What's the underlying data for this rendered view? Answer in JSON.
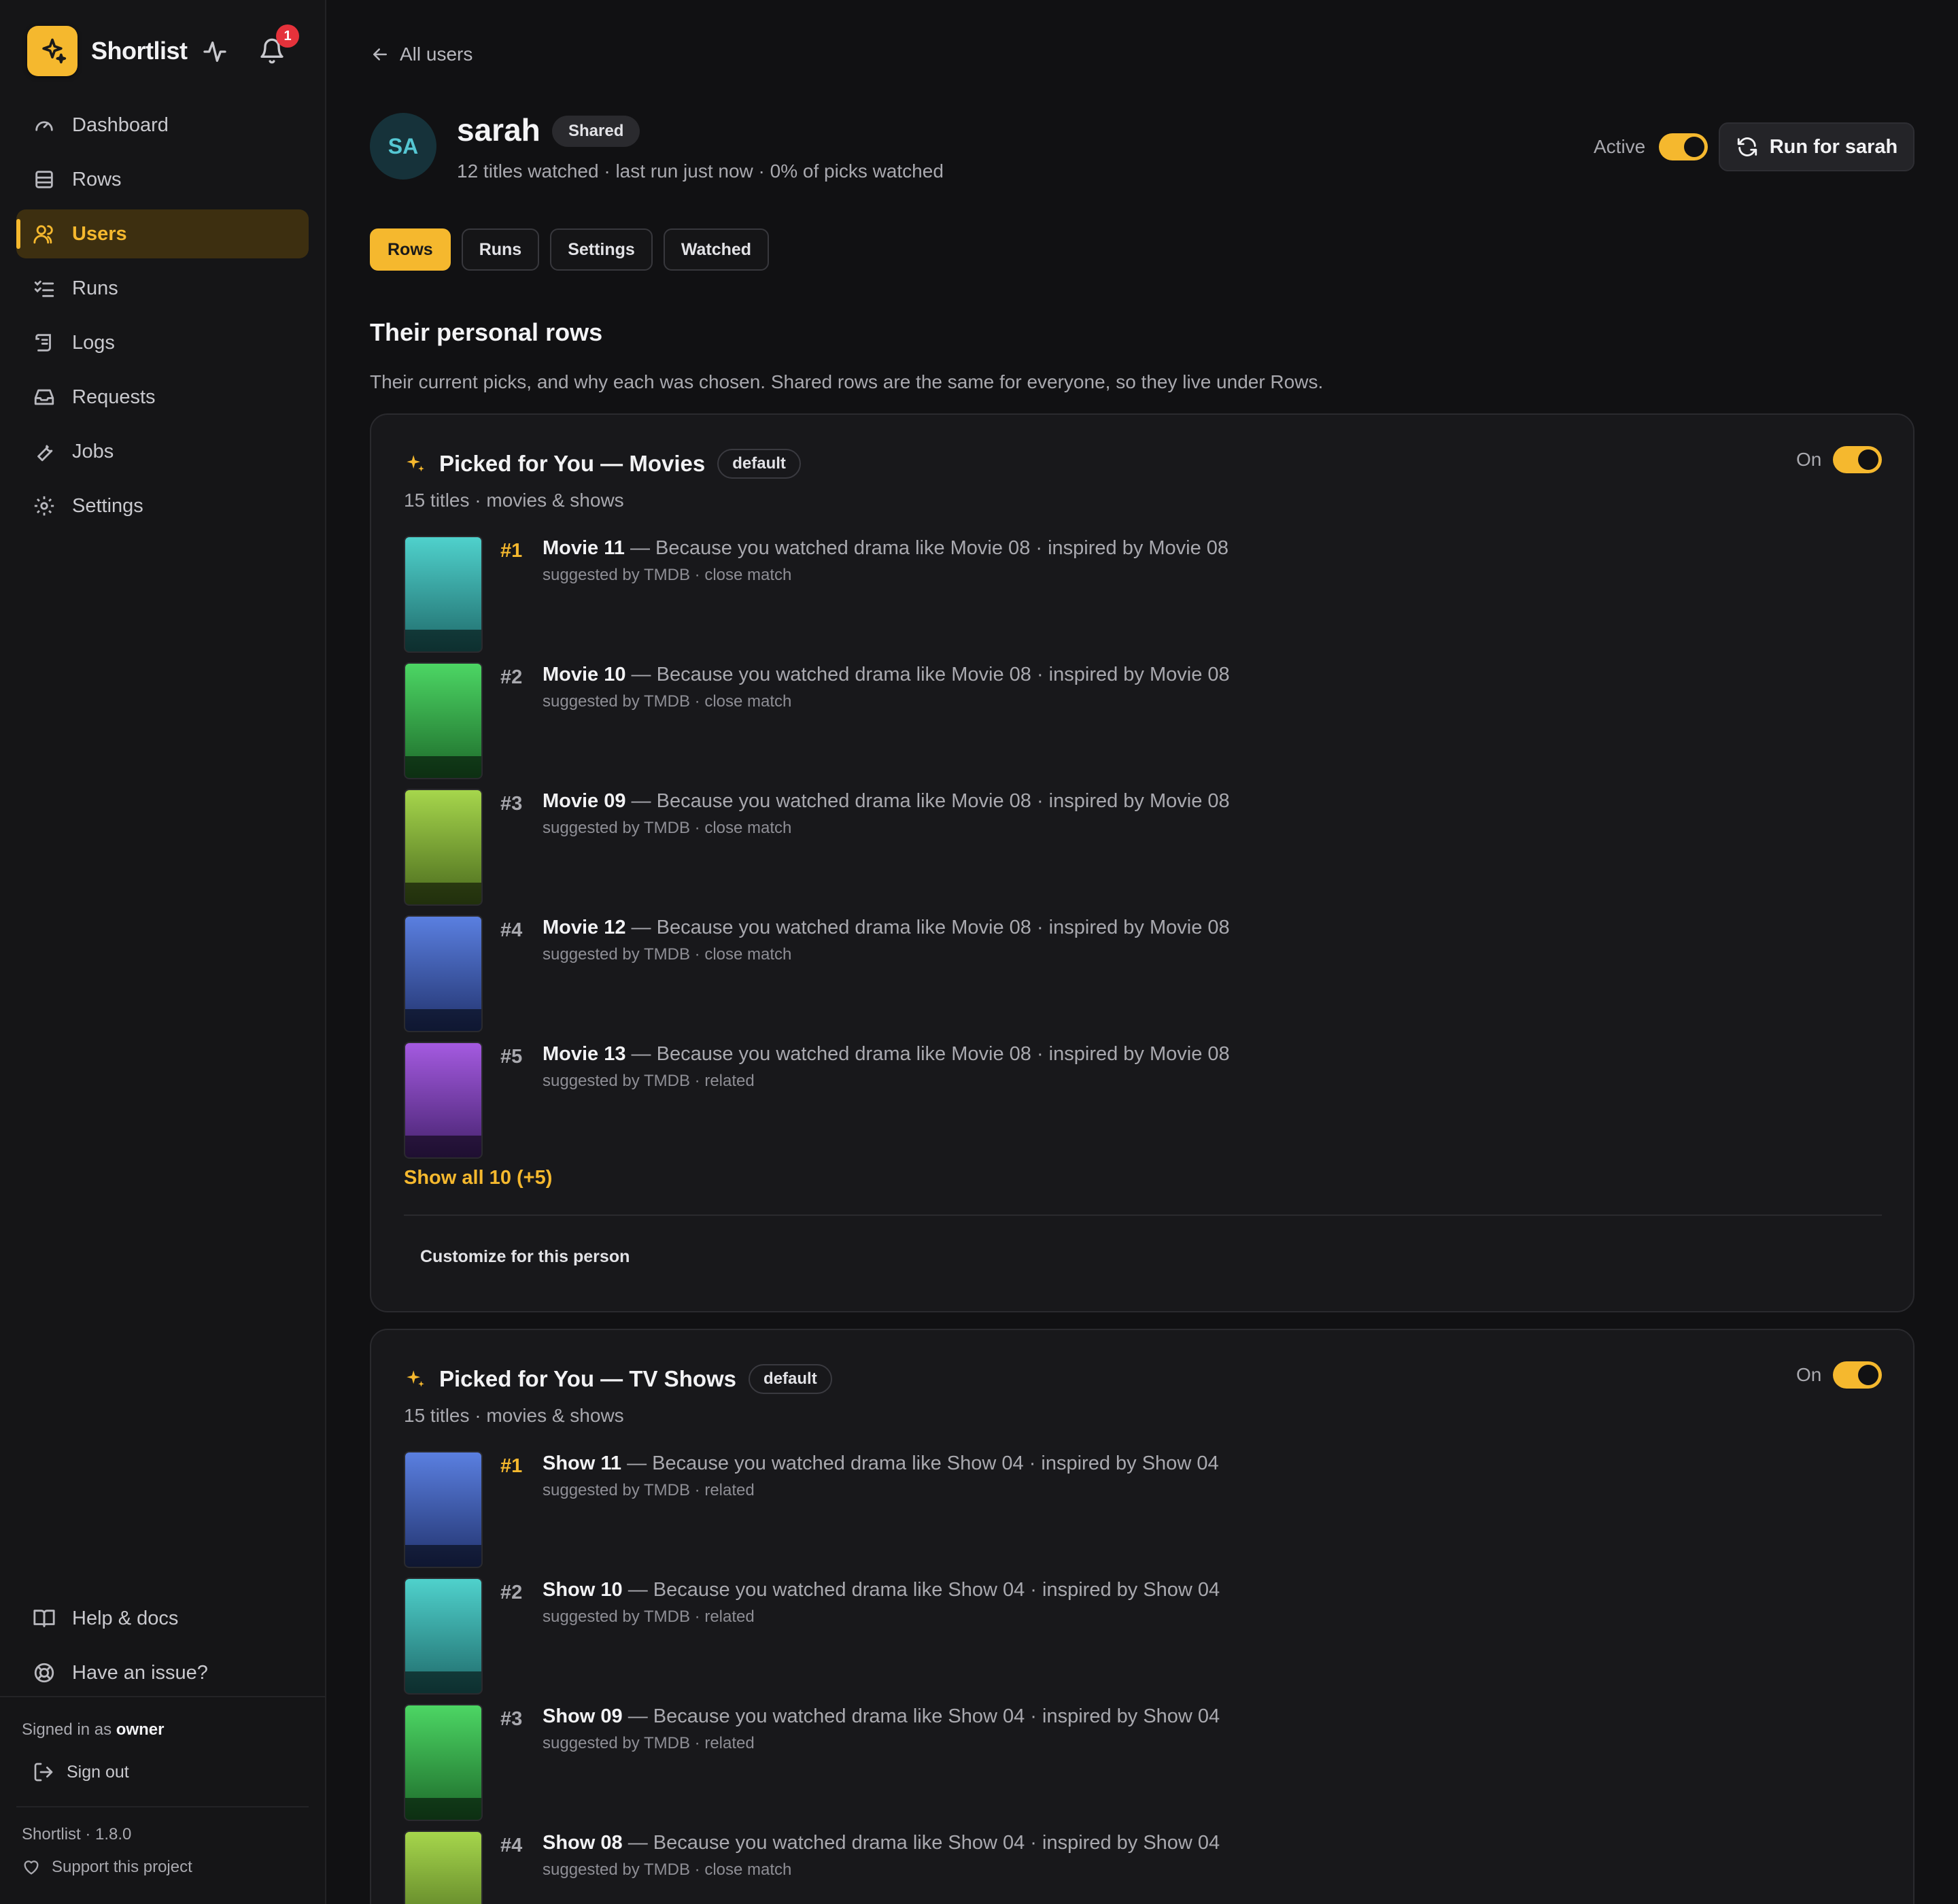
{
  "app": {
    "name": "Shortlist",
    "notification_count": "1",
    "accent": "#f5b82e"
  },
  "sidebar": {
    "items": [
      {
        "label": "Dashboard",
        "icon": "gauge-icon"
      },
      {
        "label": "Rows",
        "icon": "rows-icon"
      },
      {
        "label": "Users",
        "icon": "users-icon",
        "active": true
      },
      {
        "label": "Runs",
        "icon": "list-checks-icon"
      },
      {
        "label": "Logs",
        "icon": "scroll-icon"
      },
      {
        "label": "Requests",
        "icon": "inbox-icon"
      },
      {
        "label": "Jobs",
        "icon": "wrench-icon"
      },
      {
        "label": "Settings",
        "icon": "gear-icon"
      }
    ],
    "bottom": [
      {
        "label": "Help & docs",
        "icon": "book-icon"
      },
      {
        "label": "Have an issue?",
        "icon": "lifebuoy-icon"
      }
    ],
    "signed_in_prefix": "Signed in as",
    "signed_in_user": "owner",
    "sign_out": "Sign out",
    "version": "Shortlist · 1.8.0",
    "support": "Support this project"
  },
  "header": {
    "back_label": "All users",
    "avatar_initials": "SA",
    "username": "sarah",
    "badge": "Shared",
    "subtitle": "12 titles watched · last run just now · 0% of picks watched",
    "active_label": "Active",
    "active_on": true,
    "run_button": "Run for sarah"
  },
  "tabs": [
    {
      "label": "Rows",
      "active": true
    },
    {
      "label": "Runs"
    },
    {
      "label": "Settings"
    },
    {
      "label": "Watched"
    }
  ],
  "section": {
    "title": "Their personal rows",
    "description": "Their current picks, and why each was chosen. Shared rows are the same for everyone, so they live under Rows."
  },
  "rows": [
    {
      "title": "Picked for You — Movies",
      "badge": "default",
      "subtitle": "15 titles · movies & shows",
      "toggle_label": "On",
      "items": [
        {
          "rank": "#1",
          "title": "Movie 11",
          "reason": " — Because you watched drama like Movie 08 · inspired by Movie 08",
          "meta": "suggested by TMDB · close match",
          "color_top": "#4fd1cc",
          "color_bottom": "#1f6a6a"
        },
        {
          "rank": "#2",
          "title": "Movie 10",
          "reason": " — Because you watched drama like Movie 08 · inspired by Movie 08",
          "meta": "suggested by TMDB · close match",
          "color_top": "#4cd664",
          "color_bottom": "#1d6a2a"
        },
        {
          "rank": "#3",
          "title": "Movie 09",
          "reason": " — Because you watched drama like Movie 08 · inspired by Movie 08",
          "meta": "suggested by TMDB · close match",
          "color_top": "#a6d64c",
          "color_bottom": "#4a6a1d"
        },
        {
          "rank": "#4",
          "title": "Movie 12",
          "reason": " — Because you watched drama like Movie 08 · inspired by Movie 08",
          "meta": "suggested by TMDB · close match",
          "color_top": "#5a7fe0",
          "color_bottom": "#22336e"
        },
        {
          "rank": "#5",
          "title": "Movie 13",
          "reason": " — Because you watched drama like Movie 08 · inspired by Movie 08",
          "meta": "suggested by TMDB · related",
          "color_top": "#a45ae0",
          "color_bottom": "#45226e"
        }
      ],
      "show_all": "Show all 10 (+5)",
      "customize": "Customize for this person"
    },
    {
      "title": "Picked for You — TV Shows",
      "badge": "default",
      "subtitle": "15 titles · movies & shows",
      "toggle_label": "On",
      "items": [
        {
          "rank": "#1",
          "title": "Show 11",
          "reason": " — Because you watched drama like Show 04 · inspired by Show 04",
          "meta": "suggested by TMDB · related",
          "color_top": "#5a7fe0",
          "color_bottom": "#22336e"
        },
        {
          "rank": "#2",
          "title": "Show 10",
          "reason": " — Because you watched drama like Show 04 · inspired by Show 04",
          "meta": "suggested by TMDB · related",
          "color_top": "#4fd1cc",
          "color_bottom": "#1f6a6a"
        },
        {
          "rank": "#3",
          "title": "Show 09",
          "reason": " — Because you watched drama like Show 04 · inspired by Show 04",
          "meta": "suggested by TMDB · related",
          "color_top": "#4cd664",
          "color_bottom": "#1d6a2a"
        },
        {
          "rank": "#4",
          "title": "Show 08",
          "reason": " — Because you watched drama like Show 04 · inspired by Show 04",
          "meta": "suggested by TMDB · close match",
          "color_top": "#a6d64c",
          "color_bottom": "#4a6a1d"
        }
      ]
    }
  ]
}
